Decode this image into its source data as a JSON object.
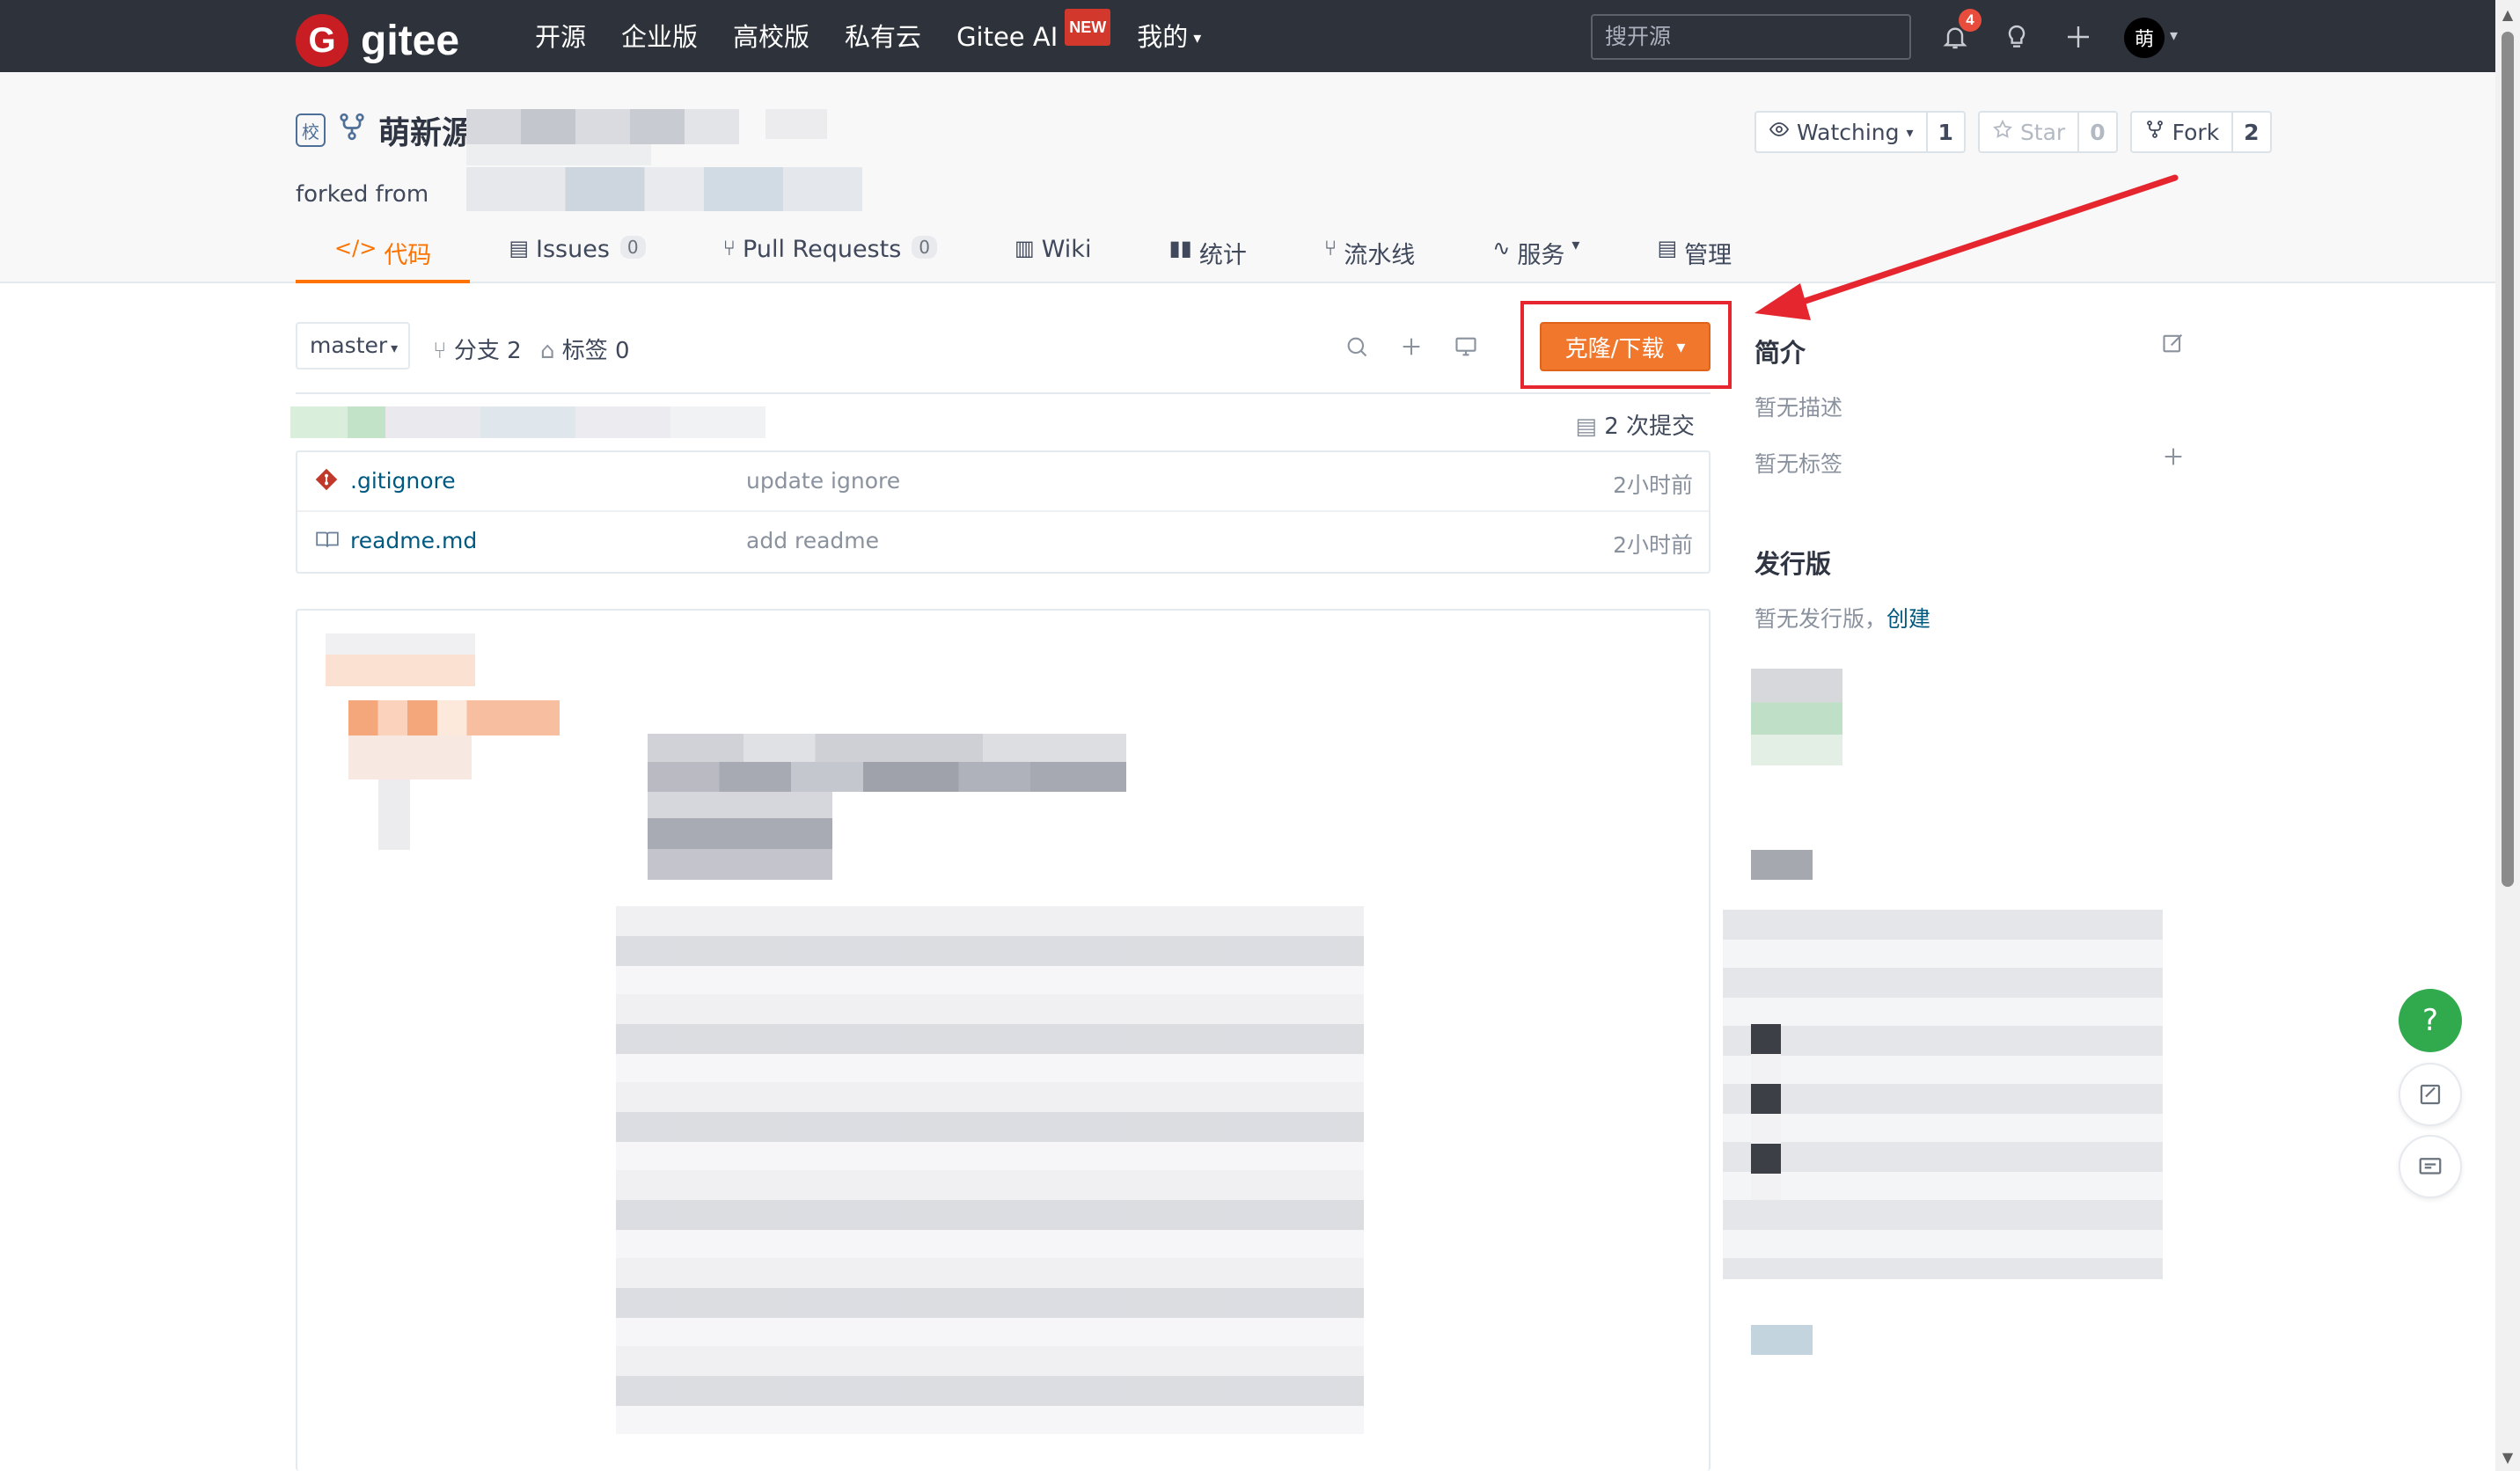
{
  "nav": {
    "logo_mark": "G",
    "logo_text": "gitee",
    "links": [
      "开源",
      "企业版",
      "高校版",
      "私有云",
      "Gitee AI",
      "我的"
    ],
    "new_badge": "NEW",
    "mine_caret": "▾",
    "search_placeholder": "搜开源",
    "notification_count": "4",
    "avatar_text": "萌",
    "avatar_caret": "▾"
  },
  "project": {
    "school_badge": "校",
    "name": "萌新源",
    "forked_from_label": "forked from",
    "watch": {
      "label": "Watching",
      "count": "1"
    },
    "star": {
      "label": "Star",
      "count": "0"
    },
    "fork": {
      "label": "Fork",
      "count": "2"
    }
  },
  "tabs": [
    {
      "icon": "</>",
      "label": "代码"
    },
    {
      "icon": "▤",
      "label": "Issues",
      "count": "0"
    },
    {
      "icon": "⑂",
      "label": "Pull Requests",
      "count": "0"
    },
    {
      "icon": "▥",
      "label": "Wiki"
    },
    {
      "icon": "▮▮",
      "label": "统计"
    },
    {
      "icon": "⑂",
      "label": "流水线"
    },
    {
      "icon": "∿",
      "label": "服务",
      "caret": "▾"
    },
    {
      "icon": "▤",
      "label": "管理"
    }
  ],
  "repo": {
    "branch": "master",
    "branch_caret": "▾",
    "branches_label": "分支 2",
    "tags_label": "标签 0",
    "clone_label": "克隆/下载",
    "clone_caret": "▾",
    "commits_label": "2 次提交",
    "files": [
      {
        "name": ".gitignore",
        "message": "update ignore",
        "time": "2小时前",
        "icon": "git-file-icon"
      },
      {
        "name": "readme.md",
        "message": "add readme",
        "time": "2小时前",
        "icon": "readme-file-icon"
      }
    ]
  },
  "sidebar": {
    "intro_title": "简介",
    "no_description": "暂无描述",
    "no_tags": "暂无标签",
    "releases_title": "发行版",
    "no_releases": "暂无发行版，",
    "create_link": "创建"
  },
  "floating": {
    "help": "?"
  },
  "colors": {
    "nav_bg": "#2e323a",
    "accent_orange": "#f0772c",
    "highlight_red": "#e6262f",
    "link_blue": "#005980",
    "help_green": "#31a94d"
  }
}
